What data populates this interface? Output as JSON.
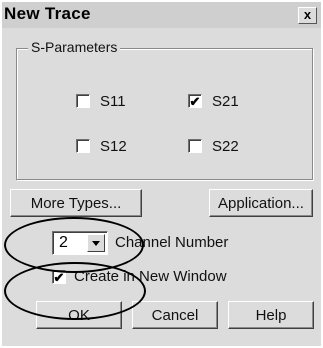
{
  "dialog": {
    "title": "New Trace",
    "close_glyph": "x"
  },
  "sparams": {
    "group_label": "S-Parameters",
    "items": [
      {
        "label": "S11",
        "checked": false
      },
      {
        "label": "S21",
        "checked": true
      },
      {
        "label": "S12",
        "checked": false
      },
      {
        "label": "S22",
        "checked": false
      }
    ]
  },
  "buttons": {
    "more_types": "More Types...",
    "application": "Application...",
    "ok": "OK",
    "cancel": "Cancel",
    "help": "Help"
  },
  "channel": {
    "value": "2",
    "label": "Channel Number"
  },
  "new_window": {
    "label": "Create in New Window",
    "checked": true
  },
  "check_glyph": "✔"
}
